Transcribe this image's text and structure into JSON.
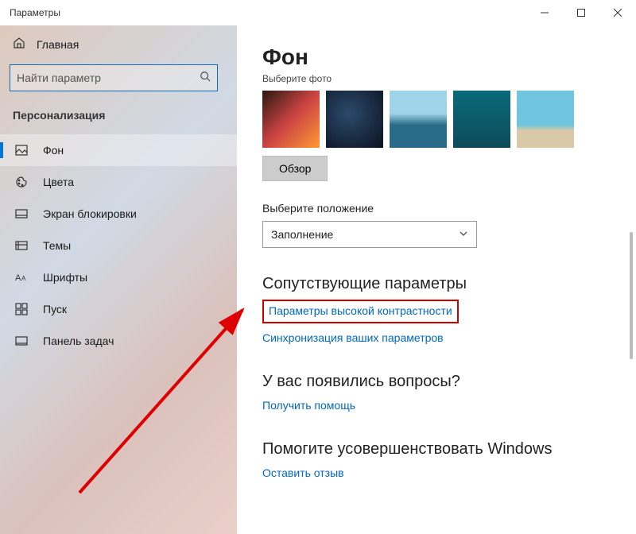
{
  "window": {
    "title": "Параметры"
  },
  "sidebar": {
    "home": "Главная",
    "search_placeholder": "Найти параметр",
    "category": "Персонализация",
    "items": [
      {
        "label": "Фон"
      },
      {
        "label": "Цвета"
      },
      {
        "label": "Экран блокировки"
      },
      {
        "label": "Темы"
      },
      {
        "label": "Шрифты"
      },
      {
        "label": "Пуск"
      },
      {
        "label": "Панель задач"
      }
    ]
  },
  "content": {
    "title": "Фон",
    "choose_photo": "Выберите фото",
    "browse": "Обзор",
    "choose_fit": "Выберите положение",
    "fit_value": "Заполнение",
    "related_heading": "Сопутствующие параметры",
    "link_contrast": "Параметры высокой контрастности",
    "link_sync": "Синхронизация ваших параметров",
    "questions_heading": "У вас появились вопросы?",
    "link_help": "Получить помощь",
    "improve_heading": "Помогите усовершенствовать Windows",
    "link_feedback": "Оставить отзыв"
  }
}
